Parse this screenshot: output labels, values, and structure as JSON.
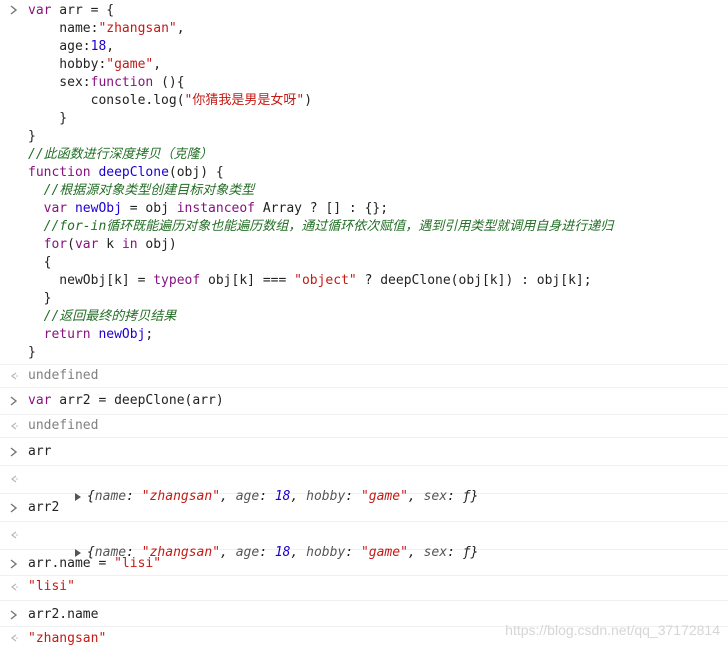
{
  "input1": {
    "lines": [
      [
        {
          "t": "var",
          "c": "code-kw"
        },
        {
          "t": " arr = {",
          "c": ""
        }
      ],
      [
        {
          "t": "    name:",
          "c": ""
        },
        {
          "t": "\"zhangsan\"",
          "c": "str"
        },
        {
          "t": ",",
          "c": ""
        }
      ],
      [
        {
          "t": "    age:",
          "c": ""
        },
        {
          "t": "18",
          "c": "num"
        },
        {
          "t": ",",
          "c": ""
        }
      ],
      [
        {
          "t": "    hobby:",
          "c": ""
        },
        {
          "t": "\"game\"",
          "c": "str"
        },
        {
          "t": ",",
          "c": ""
        }
      ],
      [
        {
          "t": "    sex:",
          "c": ""
        },
        {
          "t": "function",
          "c": "code-kw"
        },
        {
          "t": " (){",
          "c": ""
        }
      ],
      [
        {
          "t": "        console.log(",
          "c": ""
        },
        {
          "t": "\"你猜我是男是女呀\"",
          "c": "str"
        },
        {
          "t": ")",
          "c": ""
        }
      ],
      [
        {
          "t": "    }",
          "c": ""
        }
      ],
      [
        {
          "t": "}",
          "c": ""
        }
      ],
      [
        {
          "t": "//此函数进行深度拷贝（克隆）",
          "c": "cm"
        }
      ],
      [
        {
          "t": "function",
          "c": "code-kw"
        },
        {
          "t": " ",
          "c": ""
        },
        {
          "t": "deepClone",
          "c": "fn"
        },
        {
          "t": "(obj) {",
          "c": ""
        }
      ],
      [
        {
          "t": "  ",
          "c": ""
        },
        {
          "t": "//根据源对象类型创建目标对象类型",
          "c": "cm"
        }
      ],
      [
        {
          "t": "  ",
          "c": ""
        },
        {
          "t": "var",
          "c": "code-kw"
        },
        {
          "t": " ",
          "c": ""
        },
        {
          "t": "newObj",
          "c": "fn"
        },
        {
          "t": " = obj ",
          "c": ""
        },
        {
          "t": "instanceof",
          "c": "code-kw"
        },
        {
          "t": " Array ? [] : {};",
          "c": ""
        }
      ],
      [
        {
          "t": "  ",
          "c": ""
        },
        {
          "t": "//for-in循环既能遍历对象也能遍历数组，通过循环依次赋值，遇到引用类型就调用自身进行递归",
          "c": "cm"
        }
      ],
      [
        {
          "t": "  ",
          "c": ""
        },
        {
          "t": "for",
          "c": "code-kw"
        },
        {
          "t": "(",
          "c": ""
        },
        {
          "t": "var",
          "c": "code-kw"
        },
        {
          "t": " k ",
          "c": ""
        },
        {
          "t": "in",
          "c": "code-kw"
        },
        {
          "t": " obj)",
          "c": ""
        }
      ],
      [
        {
          "t": "  {",
          "c": ""
        }
      ],
      [
        {
          "t": "    newObj[k] = ",
          "c": ""
        },
        {
          "t": "typeof",
          "c": "code-kw"
        },
        {
          "t": " obj[k] === ",
          "c": ""
        },
        {
          "t": "\"object\"",
          "c": "str"
        },
        {
          "t": " ? deepClone(obj[k]) : obj[k];",
          "c": ""
        }
      ],
      [
        {
          "t": "  }",
          "c": ""
        }
      ],
      [
        {
          "t": "  ",
          "c": ""
        },
        {
          "t": "//返回最终的拷贝结果",
          "c": "cm"
        }
      ],
      [
        {
          "t": "  ",
          "c": ""
        },
        {
          "t": "return",
          "c": "code-kw"
        },
        {
          "t": " ",
          "c": ""
        },
        {
          "t": "newObj",
          "c": "fn"
        },
        {
          "t": ";",
          "c": ""
        }
      ],
      [
        {
          "t": "}",
          "c": ""
        }
      ]
    ]
  },
  "result1": "undefined",
  "input2": [
    {
      "t": "var",
      "c": "code-kw"
    },
    {
      "t": " arr2 = deepClone(arr)",
      "c": ""
    }
  ],
  "result2": "undefined",
  "input3": "arr",
  "result3": {
    "prefix": "{",
    "items": [
      {
        "k": "name",
        "v": "\"zhangsan\"",
        "type": "s"
      },
      {
        "k": "age",
        "v": "18",
        "type": "n"
      },
      {
        "k": "hobby",
        "v": "\"game\"",
        "type": "s"
      },
      {
        "k": "sex",
        "v": "ƒ",
        "type": "f"
      }
    ],
    "suffix": "}"
  },
  "input4": "arr2",
  "result4": {
    "prefix": "{",
    "items": [
      {
        "k": "name",
        "v": "\"zhangsan\"",
        "type": "s"
      },
      {
        "k": "age",
        "v": "18",
        "type": "n"
      },
      {
        "k": "hobby",
        "v": "\"game\"",
        "type": "s"
      },
      {
        "k": "sex",
        "v": "ƒ",
        "type": "f"
      }
    ],
    "suffix": "}"
  },
  "input5": [
    {
      "t": "arr.name = ",
      "c": ""
    },
    {
      "t": "\"lisi\"",
      "c": "str"
    }
  ],
  "result5": "\"lisi\"",
  "input6": "arr2.name",
  "result6": "\"zhangsan\"",
  "watermark": "https://blog.csdn.net/qq_37172814"
}
